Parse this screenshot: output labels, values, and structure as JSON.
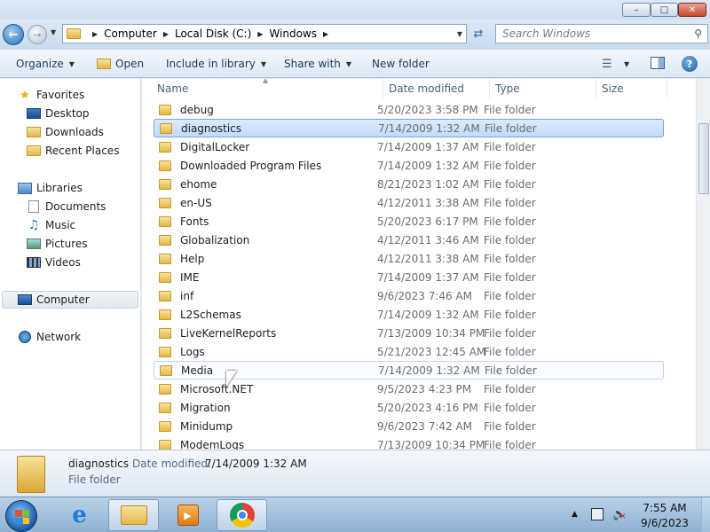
{
  "window": {
    "min": "–",
    "max": "□",
    "close": "✕"
  },
  "address": {
    "crumbs": [
      "Computer",
      "Local Disk (C:)",
      "Windows"
    ],
    "separator": "▶",
    "search_placeholder": "Search Windows"
  },
  "toolbar": {
    "organize": "Organize",
    "open": "Open",
    "include": "Include in library",
    "share": "Share with",
    "new_folder": "New folder"
  },
  "nav": {
    "favorites": "Favorites",
    "desktop": "Desktop",
    "downloads": "Downloads",
    "recent": "Recent Places",
    "libraries": "Libraries",
    "documents": "Documents",
    "music": "Music",
    "pictures": "Pictures",
    "videos": "Videos",
    "computer": "Computer",
    "network": "Network"
  },
  "columns": {
    "name": "Name",
    "date": "Date modified",
    "type": "Type",
    "size": "Size"
  },
  "files": [
    {
      "name": "debug",
      "date": "5/20/2023 3:58 PM",
      "type": "File folder"
    },
    {
      "name": "diagnostics",
      "date": "7/14/2009 1:32 AM",
      "type": "File folder"
    },
    {
      "name": "DigitalLocker",
      "date": "7/14/2009 1:37 AM",
      "type": "File folder"
    },
    {
      "name": "Downloaded Program Files",
      "date": "7/14/2009 1:32 AM",
      "type": "File folder"
    },
    {
      "name": "ehome",
      "date": "8/21/2023 1:02 AM",
      "type": "File folder"
    },
    {
      "name": "en-US",
      "date": "4/12/2011 3:38 AM",
      "type": "File folder"
    },
    {
      "name": "Fonts",
      "date": "5/20/2023 6:17 PM",
      "type": "File folder"
    },
    {
      "name": "Globalization",
      "date": "4/12/2011 3:46 AM",
      "type": "File folder"
    },
    {
      "name": "Help",
      "date": "4/12/2011 3:38 AM",
      "type": "File folder"
    },
    {
      "name": "IME",
      "date": "7/14/2009 1:37 AM",
      "type": "File folder"
    },
    {
      "name": "inf",
      "date": "9/6/2023 7:46 AM",
      "type": "File folder"
    },
    {
      "name": "L2Schemas",
      "date": "7/14/2009 1:32 AM",
      "type": "File folder"
    },
    {
      "name": "LiveKernelReports",
      "date": "7/13/2009 10:34 PM",
      "type": "File folder"
    },
    {
      "name": "Logs",
      "date": "5/21/2023 12:45 AM",
      "type": "File folder"
    },
    {
      "name": "Media",
      "date": "7/14/2009 1:32 AM",
      "type": "File folder"
    },
    {
      "name": "Microsoft.NET",
      "date": "9/5/2023 4:23 PM",
      "type": "File folder"
    },
    {
      "name": "Migration",
      "date": "5/20/2023 4:16 PM",
      "type": "File folder"
    },
    {
      "name": "Minidump",
      "date": "9/6/2023 7:42 AM",
      "type": "File folder"
    },
    {
      "name": "ModemLogs",
      "date": "7/13/2009 10:34 PM",
      "type": "File folder"
    }
  ],
  "selected_index": 1,
  "hover_index": 14,
  "details": {
    "name": "diagnostics",
    "modified_label": "Date modified:",
    "modified_value": "7/14/2009 1:32 AM",
    "type": "File folder"
  },
  "taskbar": {
    "time": "7:55 AM",
    "date": "9/6/2023",
    "ie": "e",
    "media": "▶"
  }
}
